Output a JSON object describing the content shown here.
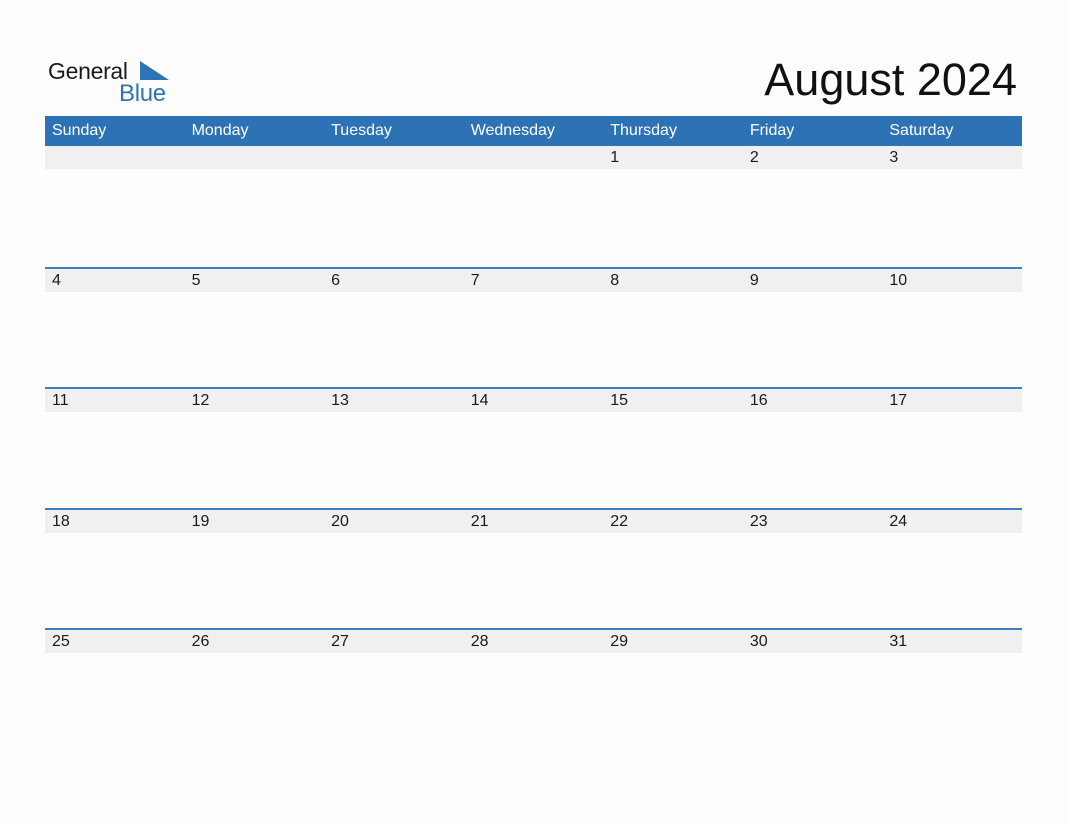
{
  "logo": {
    "line1": "General",
    "line2": "Blue",
    "accent_color": "#2e74b5"
  },
  "title": "August 2024",
  "header_color": "#2e72b6",
  "weekdays": [
    "Sunday",
    "Monday",
    "Tuesday",
    "Wednesday",
    "Thursday",
    "Friday",
    "Saturday"
  ],
  "weeks": [
    [
      "",
      "",
      "",
      "",
      "1",
      "2",
      "3"
    ],
    [
      "4",
      "5",
      "6",
      "7",
      "8",
      "9",
      "10"
    ],
    [
      "11",
      "12",
      "13",
      "14",
      "15",
      "16",
      "17"
    ],
    [
      "18",
      "19",
      "20",
      "21",
      "22",
      "23",
      "24"
    ],
    [
      "25",
      "26",
      "27",
      "28",
      "29",
      "30",
      "31"
    ]
  ]
}
